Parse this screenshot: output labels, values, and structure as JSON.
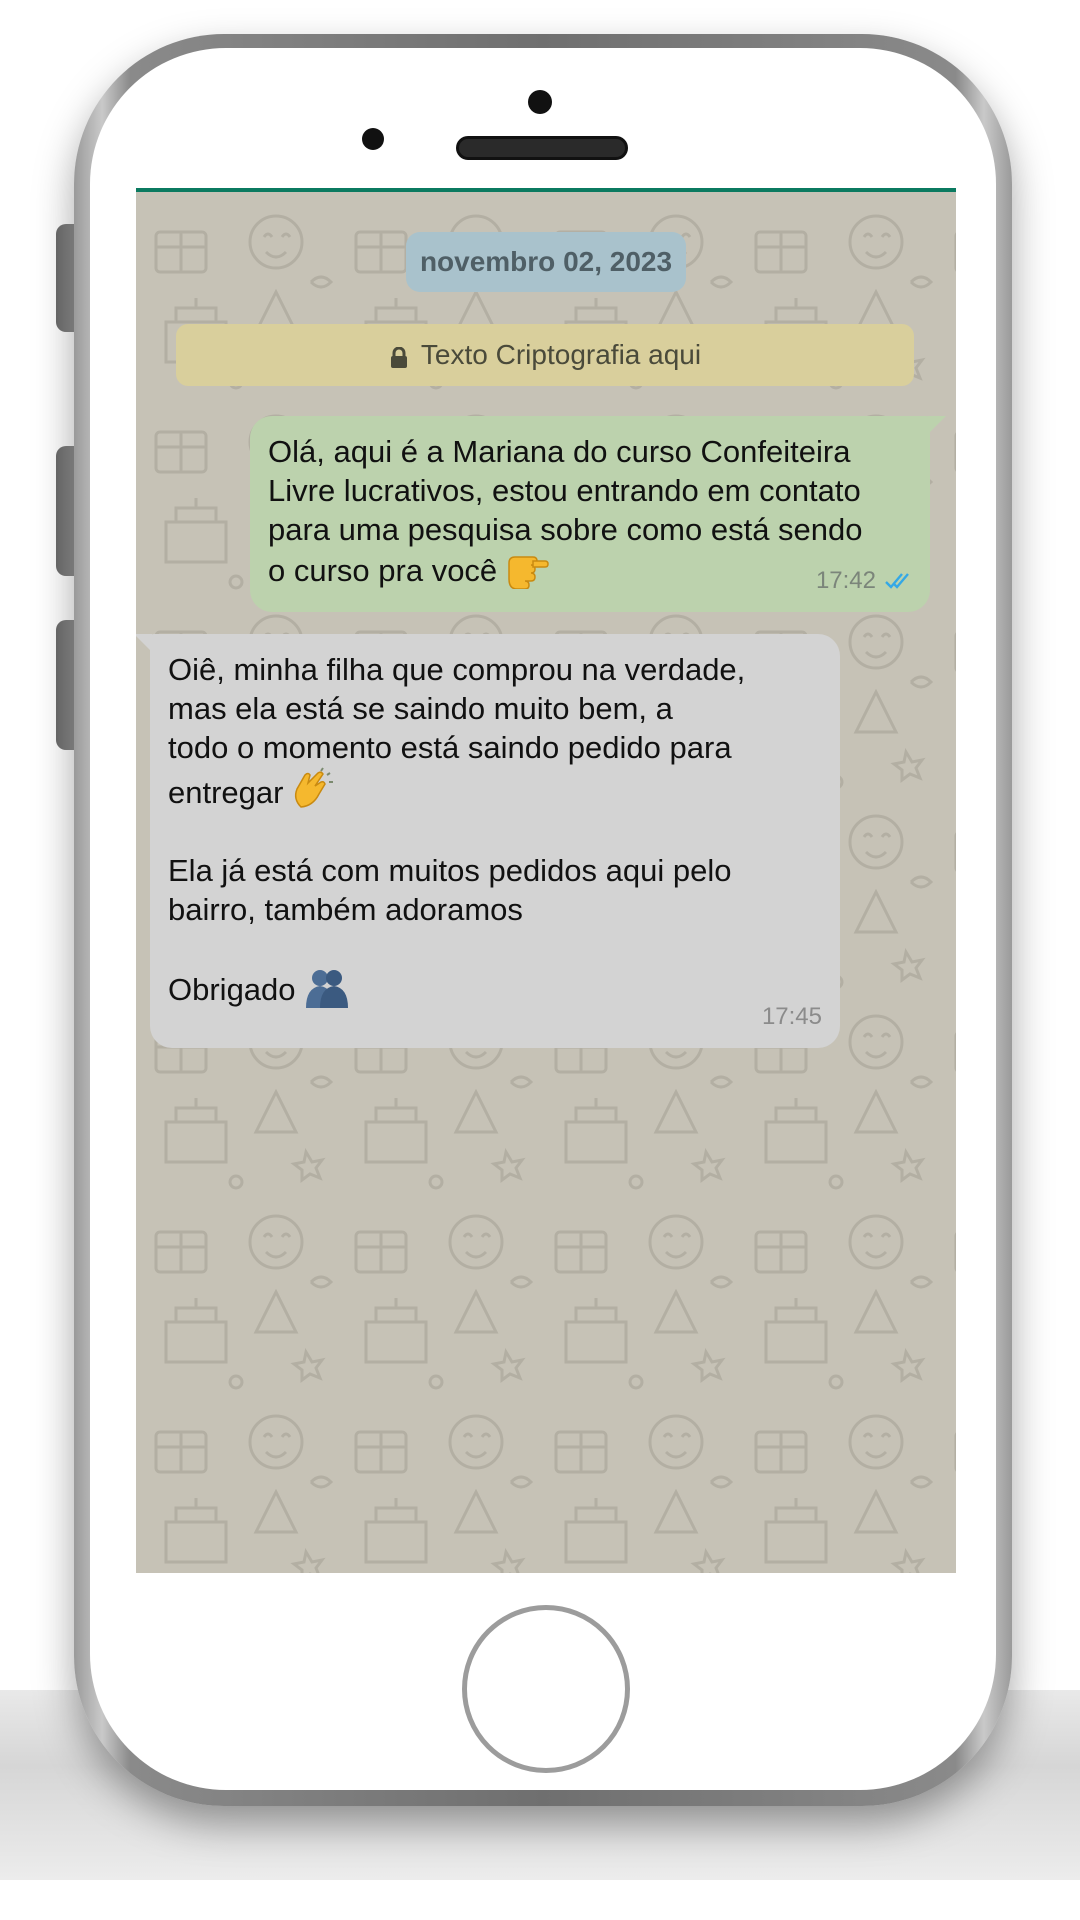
{
  "chat": {
    "date_badge": "novembro 02, 2023",
    "encryption_notice": "Texto Criptografia aqui",
    "messages": [
      {
        "direction": "outgoing",
        "lines": [
          "Olá, aqui é a Mariana do curso Confeiteira",
          "Livre lucrativos, estou entrando em contato",
          "para uma pesquisa sobre como está sendo",
          "o curso pra você"
        ],
        "emoji": "pointing-hand-icon",
        "time": "17:42",
        "status": "read-double-check"
      },
      {
        "direction": "incoming",
        "lines": [
          "Oiê, minha filha que comprou na verdade,",
          "mas ela está se saindo muito bem, a",
          "todo o momento está saindo pedido para",
          "entregar",
          "",
          "Ela já está com muitos pedidos aqui pelo",
          "bairro, também adoramos",
          "",
          "Obrigado"
        ],
        "emojis": [
          "clapping-hands-icon",
          "hug-icon"
        ],
        "time": "17:45"
      }
    ]
  },
  "colors": {
    "chat_background": "#c6c2b6",
    "outgoing_bubble": "#bcd2ad",
    "incoming_bubble": "#d3d3d3",
    "date_badge": "#a9c2cc",
    "encryption_banner": "#d9cf9c",
    "read_ticks": "#34a8e6",
    "header_accent": "#0b7a60"
  }
}
